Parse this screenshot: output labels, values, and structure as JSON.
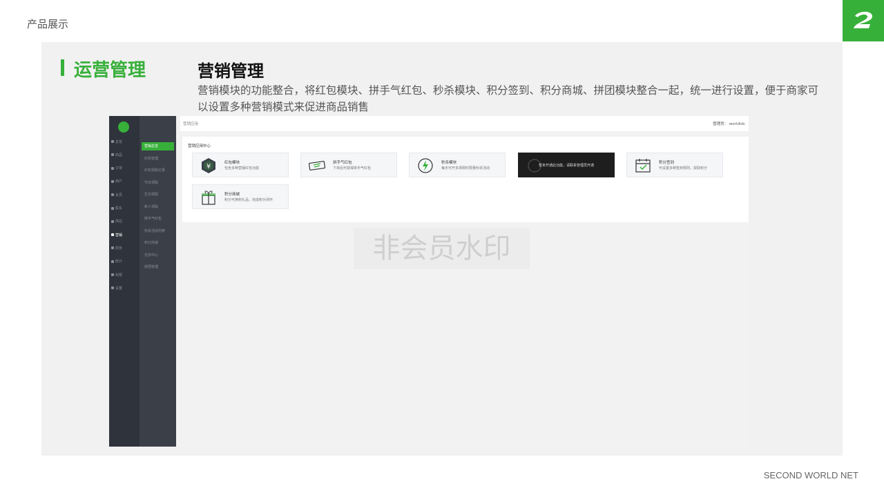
{
  "page": {
    "top_label": "产品展示",
    "footer": "SECOND WORLD NET"
  },
  "section": {
    "title": "运营管理"
  },
  "feature": {
    "title": "营销管理",
    "description": "营销模块的功能整合，将红包模块、拼手气红包、秒杀模块、积分签到、积分商城、拼团模块整合一起，统一进行设置，便于商家可以设置多种营销模式来促进商品销售"
  },
  "app": {
    "topbar": {
      "breadcrumb": "营销应用",
      "admin": "管理员： worldidc"
    },
    "card_title": "营销应用中心",
    "nav1": [
      "总览",
      "商品",
      "订单",
      "用户",
      "会员",
      "股东",
      "供应",
      "营销",
      "财务",
      "统计",
      "权限",
      "设置"
    ],
    "nav1_active": "营销",
    "nav2": [
      "营销总览",
      "红包管理",
      "红包领取记录",
      "节日领取",
      "生日领取",
      "新人领取",
      "拼手气红包",
      "秒杀活动列表",
      "积分商城",
      "任务中心",
      "拼团管理"
    ],
    "nav2_active": "营销总览",
    "modules": [
      {
        "name": "红包模块",
        "desc": "包含多种营销红包功能",
        "icon": "hexagon-yen-icon"
      },
      {
        "name": "拼手气红包",
        "desc": "下单后可获得拼手气红包",
        "icon": "ticket-icon"
      },
      {
        "name": "秒杀模块",
        "desc": "每天可开多场限时限量秒杀活动",
        "icon": "lightning-icon"
      },
      {
        "name": "",
        "desc": "",
        "lock_msg": "暂未开通此功能，请联系管理员开通",
        "icon": "locked-icon"
      },
      {
        "name": "积分签到",
        "desc": "可设置多种签到规则，获取积分",
        "icon": "calendar-check-icon"
      },
      {
        "name": "积分商城",
        "desc": "积分可换购礼品，完成积分闭环",
        "icon": "gift-icon"
      }
    ]
  },
  "watermark": "非会员水印",
  "colors": {
    "accent": "#37b03a",
    "panel": "#f1f1f1",
    "nav_dark": "#2f333b",
    "nav_sub": "#3a3f48"
  }
}
